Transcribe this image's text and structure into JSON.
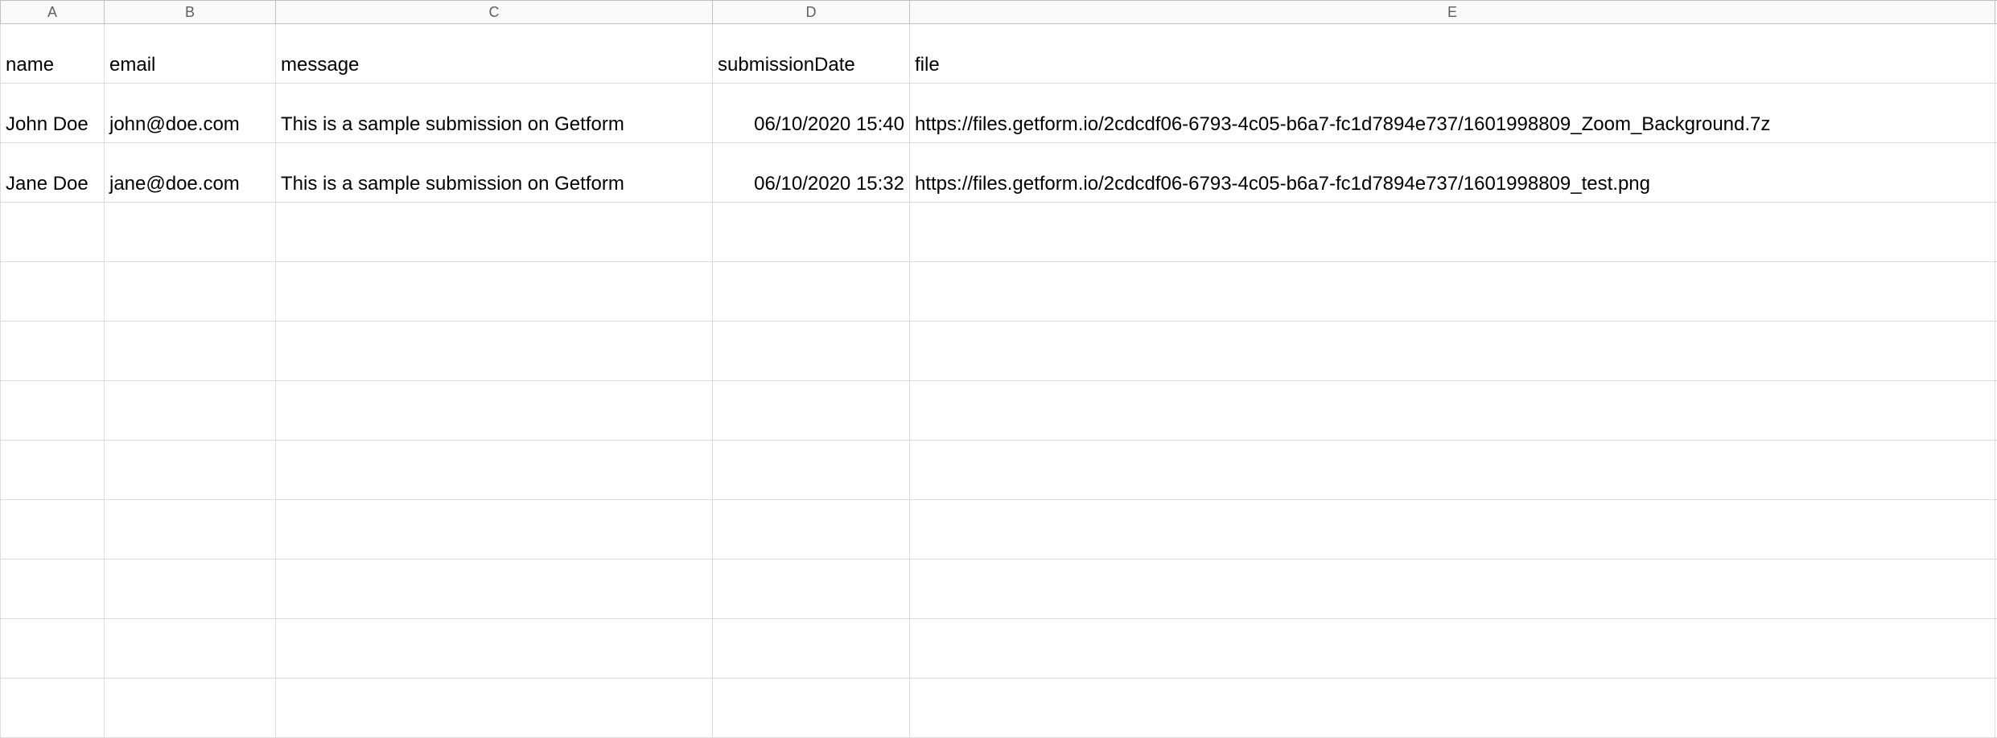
{
  "columns": [
    "A",
    "B",
    "C",
    "D",
    "E"
  ],
  "headers": {
    "A": "name",
    "B": "email",
    "C": "message",
    "D": "submissionDate",
    "E": "file"
  },
  "rows": [
    {
      "A": "John Doe",
      "B": "john@doe.com",
      "C": "This is a sample submission on Getform",
      "D": "06/10/2020 15:40",
      "E": "https://files.getform.io/2cdcdf06-6793-4c05-b6a7-fc1d7894e737/1601998809_Zoom_Background.7z"
    },
    {
      "A": "Jane Doe",
      "B": "jane@doe.com",
      "C": "This is a sample submission on Getform",
      "D": "06/10/2020 15:32",
      "E": "https://files.getform.io/2cdcdf06-6793-4c05-b6a7-fc1d7894e737/1601998809_test.png"
    }
  ],
  "empty_row_count": 9
}
